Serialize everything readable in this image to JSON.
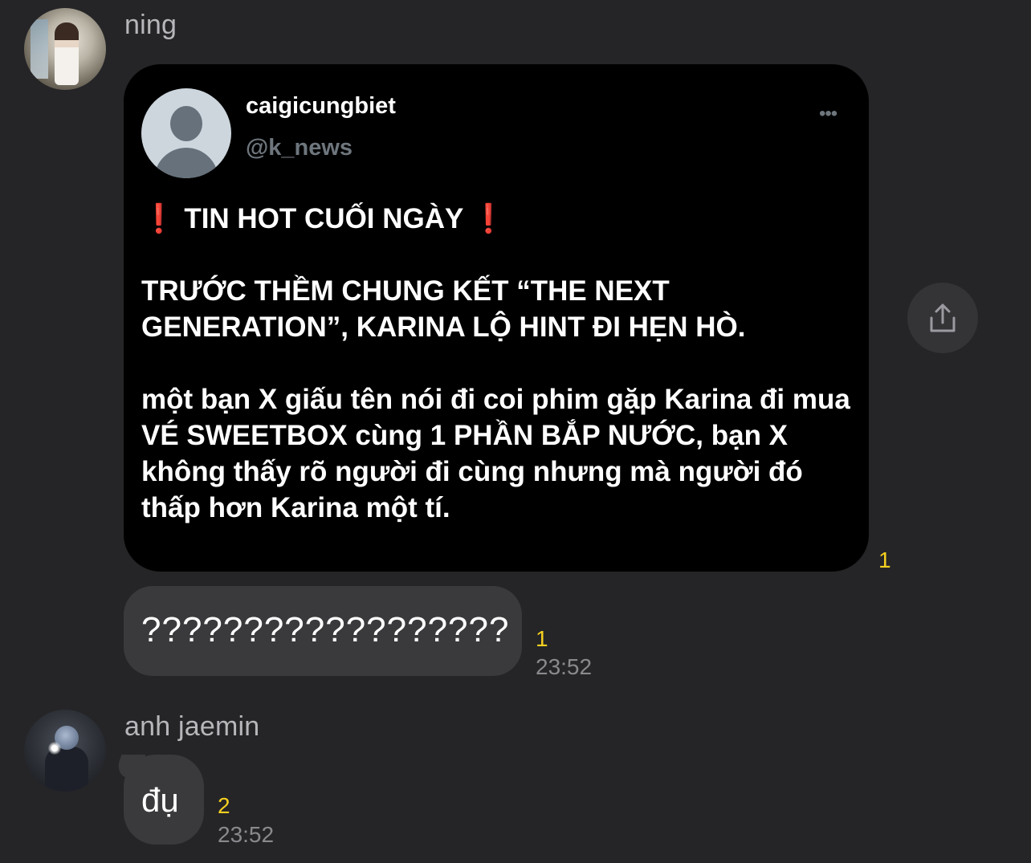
{
  "messages": [
    {
      "sender": "ning",
      "shared_post": {
        "display_name": "caigicungbiet",
        "handle": "@k_news",
        "more": "•••",
        "headline_marker": "❗",
        "headline": "TIN HOT CUỐI NGÀY",
        "paragraph_2": "TRƯỚC THỀM CHUNG KẾT “THE NEXT GENERATION”, KARINA LỘ HINT ĐI HẸN HÒ.",
        "paragraph_3": "một bạn X giấu tên nói đi coi phim gặp Karina đi mua VÉ SWEETBOX cùng 1 PHẦN BẮP NƯỚC, bạn X không thấy rõ người đi cùng nhưng mà người đó thấp hơn Karina một tí."
      },
      "shared_post_unread": "1",
      "text": "??????????????????",
      "text_unread": "1",
      "time": "23:52"
    },
    {
      "sender": "anh jaemin",
      "text": "đụ",
      "unread": "2",
      "time": "23:52"
    }
  ],
  "icons": {
    "share": "share-icon"
  },
  "colors": {
    "background": "#252527",
    "bubble": "#3a3a3d",
    "unread": "#f5d020",
    "alert": "#e0192e"
  }
}
